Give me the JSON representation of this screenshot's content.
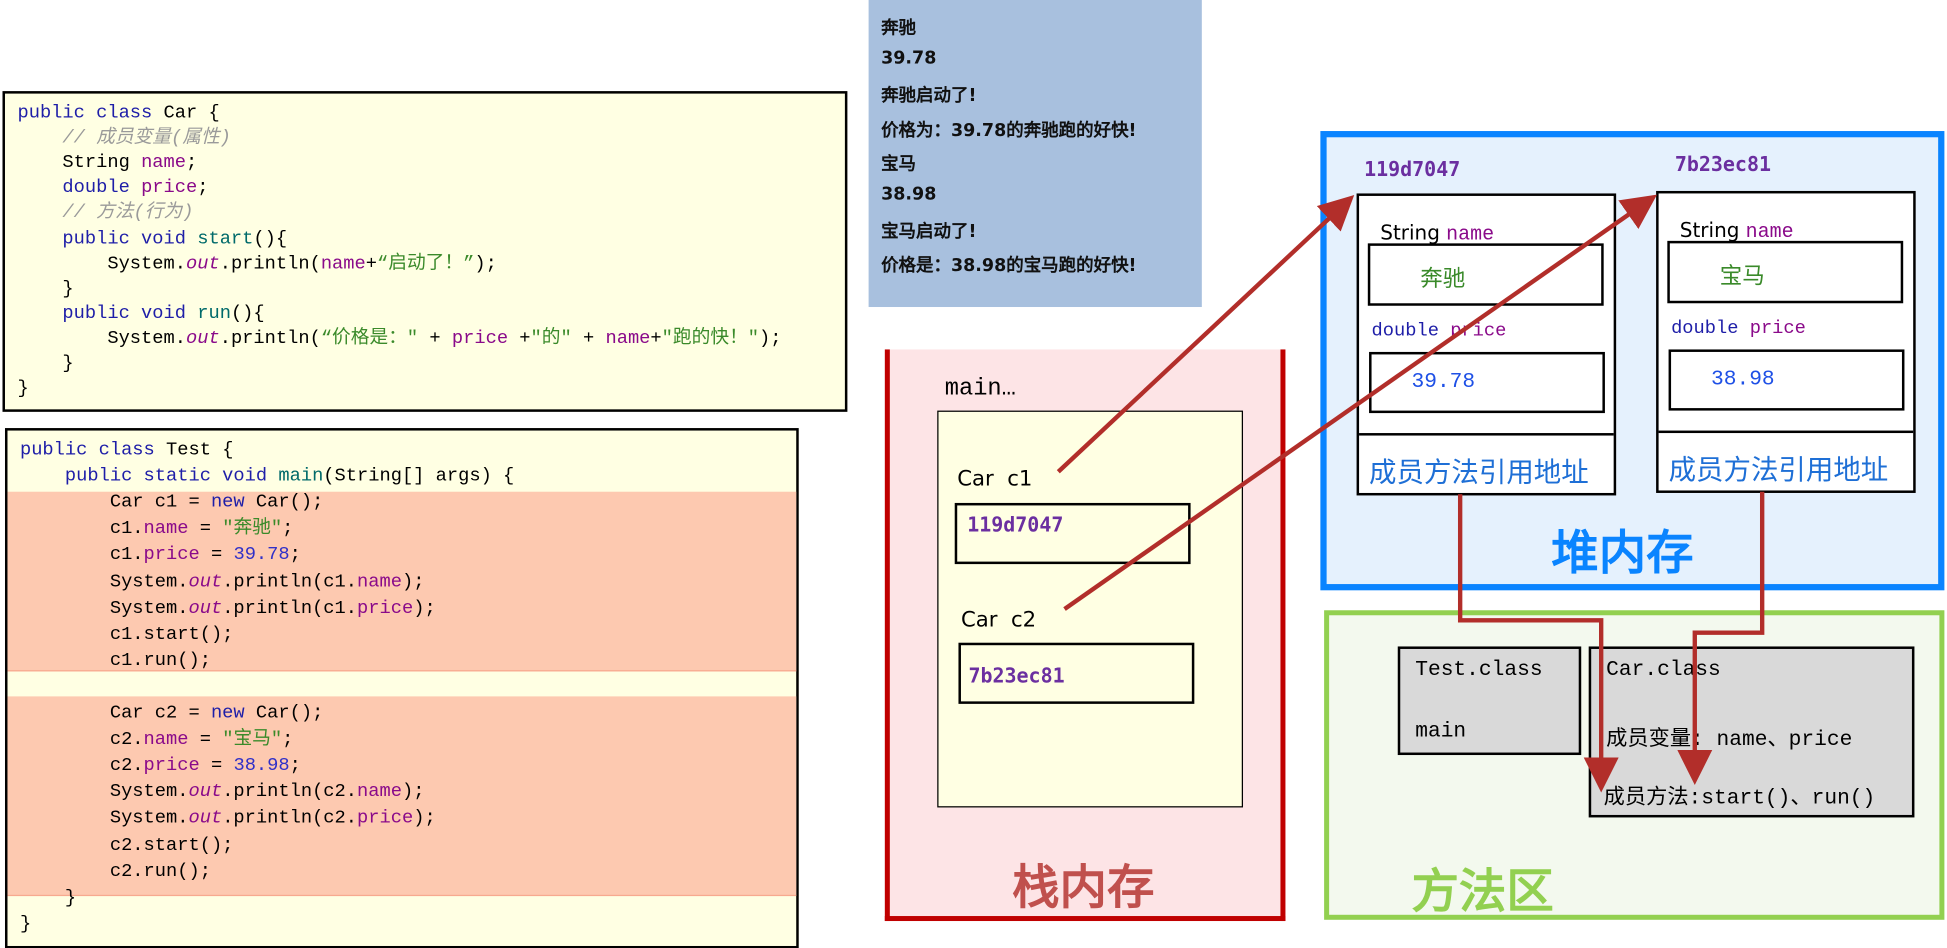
{
  "car_code": {
    "lines": [
      [
        [
          "public class ",
          "kw"
        ],
        [
          "Car {",
          ""
        ]
      ],
      [
        [
          "    // 成员变量(属性)",
          "cm"
        ]
      ],
      [
        [
          "    String ",
          ""
        ],
        [
          "name",
          "fld"
        ],
        [
          ";",
          ""
        ]
      ],
      [
        [
          "    double ",
          "kw"
        ],
        [
          "price",
          "fld"
        ],
        [
          ";",
          ""
        ]
      ],
      [
        [
          "    // 方法(行为)",
          "cm"
        ]
      ],
      [
        [
          "    public void ",
          "kw"
        ],
        [
          "start",
          "meth"
        ],
        [
          "(){",
          ""
        ]
      ],
      [
        [
          "        System.",
          ""
        ],
        [
          "out",
          "it"
        ],
        [
          ".println(",
          ""
        ],
        [
          "name",
          "fld"
        ],
        [
          "+",
          ""
        ],
        [
          "“启动了！”",
          "str"
        ],
        [
          ");",
          ""
        ]
      ],
      [
        [
          "    }",
          ""
        ]
      ],
      [
        [
          "    public void ",
          "kw"
        ],
        [
          "run",
          "meth"
        ],
        [
          "(){",
          ""
        ]
      ],
      [
        [
          "        System.",
          ""
        ],
        [
          "out",
          "it"
        ],
        [
          ".println(",
          ""
        ],
        [
          "“价格是：\"",
          "str"
        ],
        [
          " + ",
          ""
        ],
        [
          "price",
          "fld"
        ],
        [
          " +",
          ""
        ],
        [
          "\"的\"",
          "str"
        ],
        [
          " + ",
          ""
        ],
        [
          "name",
          "fld"
        ],
        [
          "+",
          ""
        ],
        [
          "\"跑的快！\"",
          "str"
        ],
        [
          ");",
          ""
        ]
      ],
      [
        [
          "    }",
          ""
        ]
      ],
      [
        [
          "}",
          ""
        ]
      ]
    ]
  },
  "test_code": {
    "lines": [
      [
        [
          "public class ",
          "kw"
        ],
        [
          "Test {",
          ""
        ]
      ],
      [
        [
          "    public static void ",
          "kw"
        ],
        [
          "main",
          "meth"
        ],
        [
          "(String[] args) {",
          ""
        ]
      ],
      [
        [
          "        Car c1 = ",
          ""
        ],
        [
          "new",
          "kw"
        ],
        [
          " Car();",
          ""
        ]
      ],
      [
        [
          "        c1.",
          ""
        ],
        [
          "name",
          "fld"
        ],
        [
          " = ",
          ""
        ],
        [
          "\"奔驰\"",
          "str"
        ],
        [
          ";",
          ""
        ]
      ],
      [
        [
          "        c1.",
          ""
        ],
        [
          "price",
          "fld"
        ],
        [
          " = ",
          ""
        ],
        [
          "39.78",
          "num"
        ],
        [
          ";",
          ""
        ]
      ],
      [
        [
          "        System.",
          ""
        ],
        [
          "out",
          "it"
        ],
        [
          ".println(c1.",
          ""
        ],
        [
          "name",
          "fld"
        ],
        [
          ");",
          ""
        ]
      ],
      [
        [
          "        System.",
          ""
        ],
        [
          "out",
          "it"
        ],
        [
          ".println(c1.",
          ""
        ],
        [
          "price",
          "fld"
        ],
        [
          ");",
          ""
        ]
      ],
      [
        [
          "        c1.start();",
          ""
        ]
      ],
      [
        [
          "        c1.run();",
          ""
        ]
      ],
      [
        [
          "",
          ""
        ]
      ],
      [
        [
          "        Car c2 = ",
          ""
        ],
        [
          "new",
          "kw"
        ],
        [
          " Car();",
          ""
        ]
      ],
      [
        [
          "        c2.",
          ""
        ],
        [
          "name",
          "fld"
        ],
        [
          " = ",
          ""
        ],
        [
          "\"宝马\"",
          "str"
        ],
        [
          ";",
          ""
        ]
      ],
      [
        [
          "        c2.",
          ""
        ],
        [
          "price",
          "fld"
        ],
        [
          " = ",
          ""
        ],
        [
          "38.98",
          "num"
        ],
        [
          ";",
          ""
        ]
      ],
      [
        [
          "        System.",
          ""
        ],
        [
          "out",
          "it"
        ],
        [
          ".println(c2.",
          ""
        ],
        [
          "name",
          "fld"
        ],
        [
          ");",
          ""
        ]
      ],
      [
        [
          "        System.",
          ""
        ],
        [
          "out",
          "it"
        ],
        [
          ".println(c2.",
          ""
        ],
        [
          "price",
          "fld"
        ],
        [
          ");",
          ""
        ]
      ],
      [
        [
          "        c2.start();",
          ""
        ]
      ],
      [
        [
          "        c2.run();",
          ""
        ]
      ],
      [
        [
          "    }",
          ""
        ]
      ],
      [
        [
          "}",
          ""
        ]
      ]
    ]
  },
  "console_output": [
    "奔驰",
    "39.78",
    "奔驰启动了!",
    "价格为：39.78的奔驰跑的好快!",
    "宝马",
    "38.98",
    "宝马启动了!",
    "价格是：38.98的宝马跑的好快!"
  ],
  "stack": {
    "title": "栈内存",
    "frame_label": "main…",
    "vars": [
      {
        "label": "Car  c1",
        "value": "119d7047"
      },
      {
        "label": "Car  c2",
        "value": "7b23ec81"
      }
    ]
  },
  "heap": {
    "title": "堆内存",
    "objects": [
      {
        "address": "119d7047",
        "name_type": "String",
        "name_field": "name",
        "name_value": "奔驰",
        "price_type": "double",
        "price_field": "price",
        "price_value": "39.78",
        "methods_ref": "成员方法引用地址"
      },
      {
        "address": "7b23ec81",
        "name_type": "String",
        "name_field": "name",
        "name_value": "宝马",
        "price_type": "double",
        "price_field": "price",
        "price_value": "38.98",
        "methods_ref": "成员方法引用地址"
      }
    ]
  },
  "method_area": {
    "title": "方法区",
    "test_class": {
      "name": "Test.class",
      "method": "main"
    },
    "car_class": {
      "name": "Car.class",
      "fields": "成员变量: name、price",
      "methods": "成员方法:start()、run()"
    }
  },
  "colors": {
    "stack": "#c00000",
    "heap": "#0a84ff",
    "method_area": "#92d050",
    "arrow": "#b22e2a",
    "address": "#6b2fa0"
  }
}
